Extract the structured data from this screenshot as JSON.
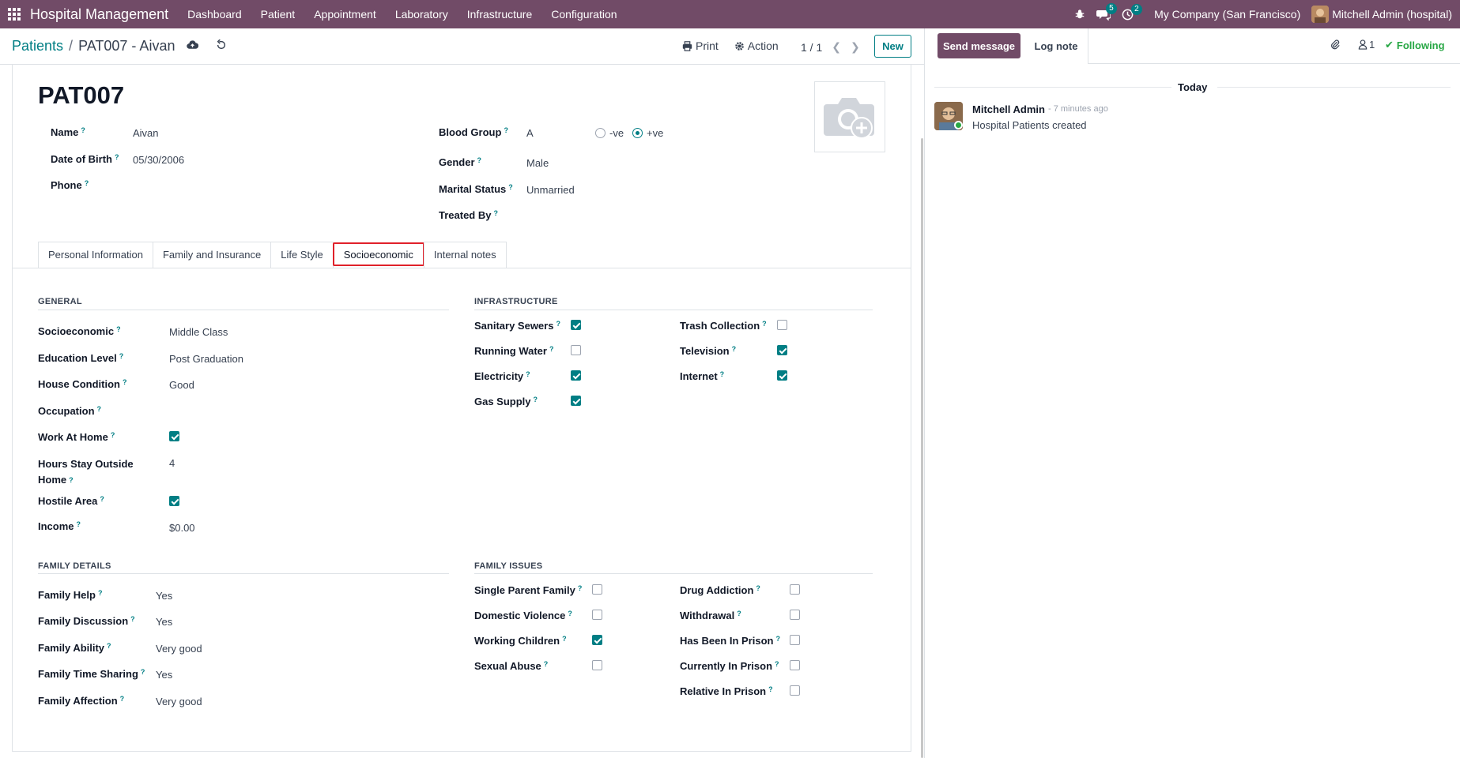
{
  "navbar": {
    "app_title": "Hospital Management",
    "menu": [
      "Dashboard",
      "Patient",
      "Appointment",
      "Laboratory",
      "Infrastructure",
      "Configuration"
    ],
    "messages_count": "5",
    "activities_count": "2",
    "company": "My Company (San Francisco)",
    "user": "Mitchell Admin (hospital)"
  },
  "control_panel": {
    "breadcrumb_parent": "Patients",
    "breadcrumb_separator": "/",
    "breadcrumb_current": "PAT007 - Aivan",
    "print_label": "Print",
    "action_label": "Action",
    "pager": "1 / 1",
    "new_label": "New"
  },
  "record": {
    "code": "PAT007",
    "fields_left": [
      {
        "label": "Name",
        "value": "Aivan"
      },
      {
        "label": "Date of Birth",
        "value": "05/30/2006"
      },
      {
        "label": "Phone",
        "value": ""
      }
    ],
    "blood_group": {
      "label": "Blood Group",
      "value": "A",
      "rh_options": [
        "-ve",
        "+ve"
      ],
      "rh_selected": "+ve"
    },
    "fields_right": [
      {
        "label": "Gender",
        "value": "Male"
      },
      {
        "label": "Marital Status",
        "value": "Unmarried"
      },
      {
        "label": "Treated By",
        "value": ""
      }
    ]
  },
  "tabs": [
    {
      "label": "Personal Information",
      "active": false
    },
    {
      "label": "Family and Insurance",
      "active": false
    },
    {
      "label": "Life Style",
      "active": false
    },
    {
      "label": "Socioeconomic",
      "active": true
    },
    {
      "label": "Internal notes",
      "active": false
    }
  ],
  "general": {
    "title": "GENERAL",
    "socioeconomic": {
      "label": "Socioeconomic",
      "value": "Middle Class"
    },
    "education_level": {
      "label": "Education Level",
      "value": "Post Graduation"
    },
    "house_condition": {
      "label": "House Condition",
      "value": "Good"
    },
    "occupation": {
      "label": "Occupation",
      "value": ""
    },
    "work_at_home": {
      "label": "Work At Home",
      "checked": true
    },
    "hours_outside": {
      "label_line1": "Hours Stay Outside",
      "label_line2": "Home",
      "value": "4"
    },
    "hostile_area": {
      "label": "Hostile Area",
      "checked": true
    },
    "income": {
      "label": "Income",
      "value": "$0.00"
    }
  },
  "infrastructure": {
    "title": "INFRASTRUCTURE",
    "left": [
      {
        "label": "Sanitary Sewers",
        "checked": true
      },
      {
        "label": "Running Water",
        "checked": false
      },
      {
        "label": "Electricity",
        "checked": true
      },
      {
        "label": "Gas Supply",
        "checked": true
      }
    ],
    "right": [
      {
        "label": "Trash Collection",
        "checked": false
      },
      {
        "label": "Television",
        "checked": true
      },
      {
        "label": "Internet",
        "checked": true
      }
    ]
  },
  "family_details": {
    "title": "FAMILY DETAILS",
    "items": [
      {
        "label": "Family Help",
        "value": "Yes"
      },
      {
        "label": "Family Discussion",
        "value": "Yes"
      },
      {
        "label": "Family Ability",
        "value": "Very good"
      },
      {
        "label": "Family Time Sharing",
        "value": "Yes"
      },
      {
        "label": "Family Affection",
        "value": "Very good"
      }
    ]
  },
  "family_issues": {
    "title": "FAMILY ISSUES",
    "left": [
      {
        "label": "Single Parent Family",
        "checked": false
      },
      {
        "label": "Domestic Violence",
        "checked": false
      },
      {
        "label": "Working Children",
        "checked": true
      },
      {
        "label": "Sexual Abuse",
        "checked": false
      }
    ],
    "right": [
      {
        "label": "Drug Addiction",
        "checked": false
      },
      {
        "label": "Withdrawal",
        "checked": false
      },
      {
        "label": "Has Been In Prison",
        "checked": false
      },
      {
        "label": "Currently In Prison",
        "checked": false
      },
      {
        "label": "Relative In Prison",
        "checked": false
      }
    ]
  },
  "chatter": {
    "send_message": "Send message",
    "log_note": "Log note",
    "followers_count": "1",
    "following_label": "Following",
    "date_separator": "Today",
    "message": {
      "author": "Mitchell Admin",
      "time": "- 7 minutes ago",
      "body": "Hospital Patients created"
    }
  },
  "colors": {
    "brand": "#714b67",
    "accent": "#017e84",
    "highlight": "#e0212a"
  }
}
